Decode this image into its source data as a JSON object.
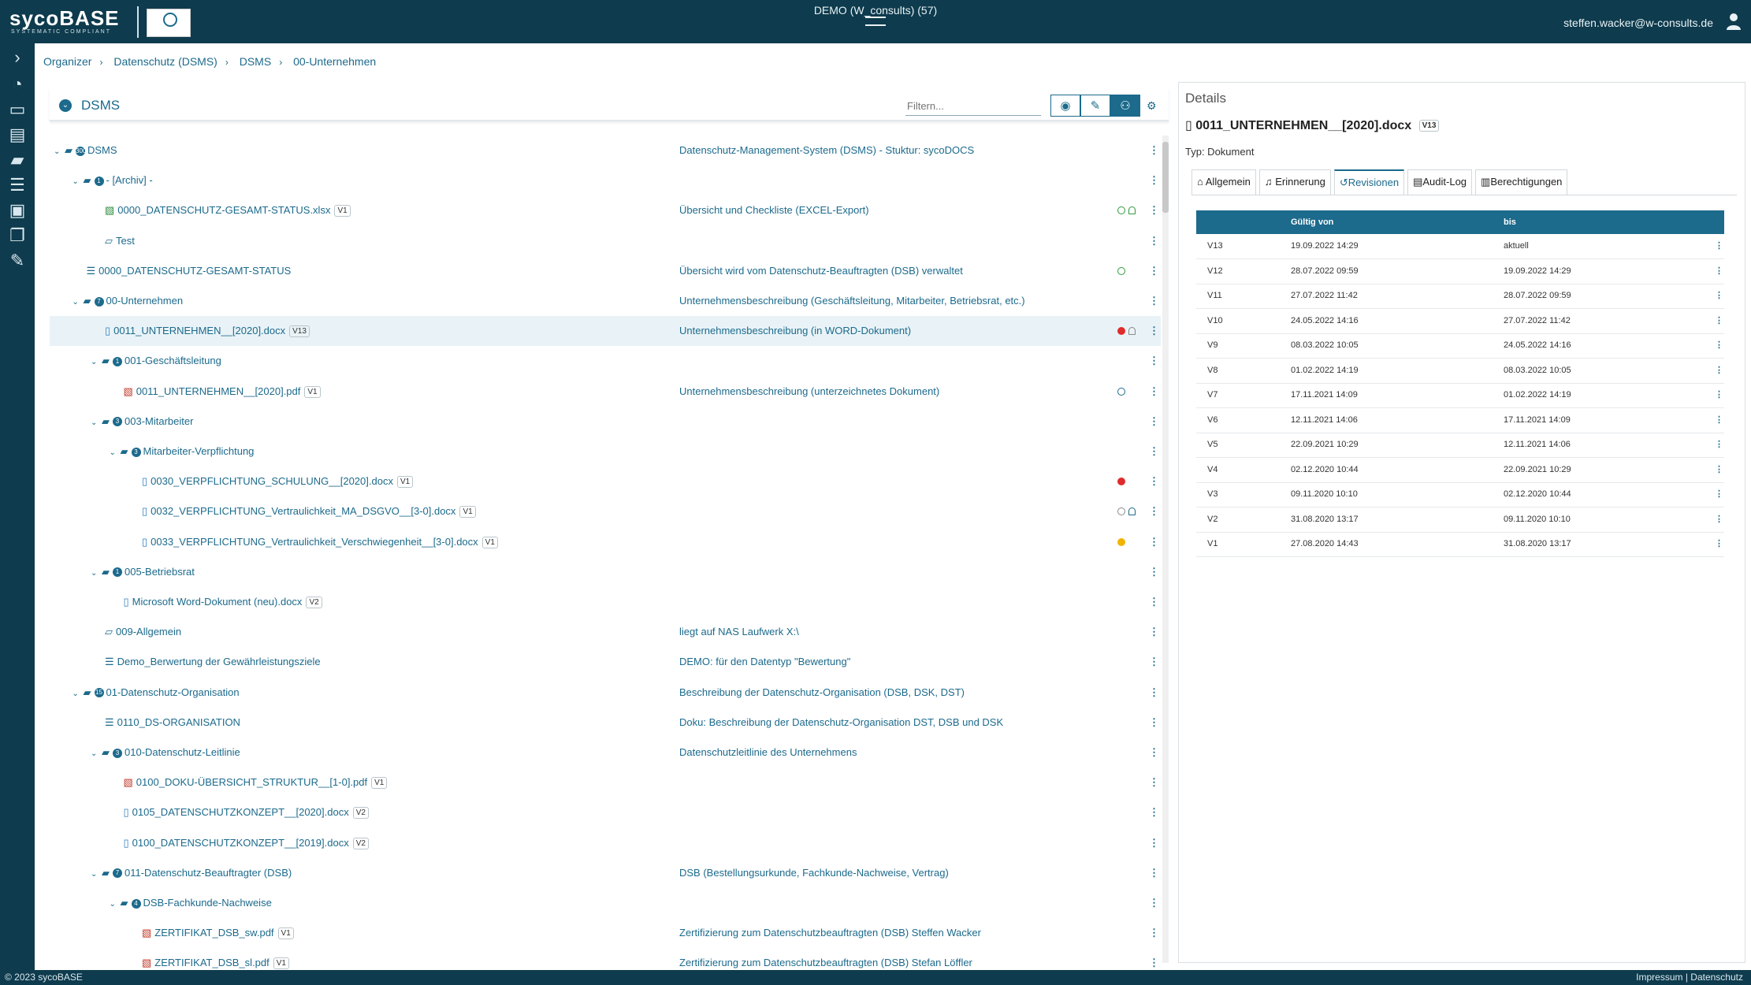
{
  "header": {
    "logo": "sycoBASE",
    "logo_tagline": "SYSTEMATIC COMPLIANT",
    "center_title": "DEMO (W_consults) (57)",
    "user_email": "steffen.wacker@w-consults.de"
  },
  "breadcrumb": [
    "Organizer",
    "Datenschutz (DSMS)",
    "DSMS",
    "00-Unternehmen"
  ],
  "left_panel": {
    "title": "DSMS",
    "filter_placeholder": "Filtern..."
  },
  "tree": [
    {
      "name": "DSMS",
      "desc": "Datenschutz-Management-System (DSMS) - Stuktur: sycoDOCS",
      "level": 0,
      "type": "folder",
      "expanded": true,
      "count": "300"
    },
    {
      "name": "- [Archiv] -",
      "desc": "",
      "level": 1,
      "type": "folder",
      "expanded": true,
      "count": "1"
    },
    {
      "name": "0000_DATENSCHUTZ-GESAMT-STATUS.xlsx",
      "version": "V1",
      "desc": "Übersicht und Checkliste (EXCEL-Export)",
      "level": 2,
      "type": "xlsx",
      "status": "ok-bell"
    },
    {
      "name": "Test",
      "desc": "",
      "level": 2,
      "type": "folder-open"
    },
    {
      "name": "0000_DATENSCHUTZ-GESAMT-STATUS",
      "desc": "Übersicht wird vom Datenschutz-Beauftragten (DSB) verwaltet",
      "level": 1,
      "type": "list",
      "status": "ok"
    },
    {
      "name": "00-Unternehmen",
      "desc": "Unternehmensbeschreibung (Geschäftsleitung, Mitarbeiter, Betriebsrat, etc.)",
      "level": 1,
      "type": "folder",
      "expanded": true,
      "count": "7"
    },
    {
      "name": "0011_UNTERNEHMEN__[2020].docx",
      "version": "V13",
      "desc": "Unternehmensbeschreibung (in WORD-Dokument)",
      "level": 2,
      "type": "doc",
      "status": "error-nobell",
      "selected": true
    },
    {
      "name": "001-Geschäftsleitung",
      "desc": "",
      "level": 2,
      "type": "folder",
      "expanded": true,
      "count": "1"
    },
    {
      "name": "0011_UNTERNEHMEN__[2020].pdf",
      "version": "V1",
      "desc": "Unternehmensbeschreibung (unterzeichnetes Dokument)",
      "level": 3,
      "type": "pdf",
      "status": "play"
    },
    {
      "name": "003-Mitarbeiter",
      "desc": "",
      "level": 2,
      "type": "folder",
      "expanded": true,
      "count": "3"
    },
    {
      "name": "Mitarbeiter-Verpflichtung",
      "desc": "",
      "level": 3,
      "type": "folder",
      "expanded": true,
      "count": "3"
    },
    {
      "name": "0030_VERPFLICHTUNG_SCHULUNG__[2020].docx",
      "version": "V1",
      "desc": "",
      "level": 4,
      "type": "doc",
      "status": "error"
    },
    {
      "name": "0032_VERPFLICHTUNG_Vertraulichkeit_MA_DSGVO__[3-0].docx",
      "version": "V1",
      "desc": "",
      "level": 4,
      "type": "doc",
      "status": "record-bell"
    },
    {
      "name": "0033_VERPFLICHTUNG_Vertraulichkeit_Verschwiegenheit__[3-0].docx",
      "version": "V1",
      "desc": "",
      "level": 4,
      "type": "doc",
      "status": "warn"
    },
    {
      "name": "005-Betriebsrat",
      "desc": "",
      "level": 2,
      "type": "folder",
      "expanded": true,
      "count": "1"
    },
    {
      "name": "Microsoft Word-Dokument (neu).docx",
      "version": "V2",
      "desc": "",
      "level": 3,
      "type": "doc"
    },
    {
      "name": "009-Allgemein",
      "desc": "liegt auf NAS Laufwerk X:\\",
      "level": 2,
      "type": "folder-open"
    },
    {
      "name": "Demo_Berwertung der Gewährleistungsziele",
      "desc": "DEMO: für den Datentyp \"Bewertung\"",
      "level": 2,
      "type": "list"
    },
    {
      "name": "01-Datenschutz-Organisation",
      "desc": "Beschreibung der Datenschutz-Organisation (DSB, DSK, DST)",
      "level": 1,
      "type": "folder",
      "expanded": true,
      "count": "15"
    },
    {
      "name": "0110_DS-ORGANISATION",
      "desc": "Doku: Beschreibung der Datenschutz-Organisation DST, DSB und DSK",
      "level": 2,
      "type": "list"
    },
    {
      "name": "010-Datenschutz-Leitlinie",
      "desc": "Datenschutzleitlinie des Unternehmens",
      "level": 2,
      "type": "folder",
      "expanded": true,
      "count": "3"
    },
    {
      "name": "0100_DOKU-ÜBERSICHT_STRUKTUR__[1-0].pdf",
      "version": "V1",
      "desc": "",
      "level": 3,
      "type": "pdf"
    },
    {
      "name": "0105_DATENSCHUTZKONZEPT__[2020].docx",
      "version": "V2",
      "desc": "",
      "level": 3,
      "type": "doc"
    },
    {
      "name": "0100_DATENSCHUTZKONZEPT__[2019].docx",
      "version": "V2",
      "desc": "",
      "level": 3,
      "type": "doc"
    },
    {
      "name": "011-Datenschutz-Beauftragter (DSB)",
      "desc": "DSB (Bestellungsurkunde, Fachkunde-Nachweise, Vertrag)",
      "level": 2,
      "type": "folder",
      "expanded": true,
      "count": "7"
    },
    {
      "name": "DSB-Fachkunde-Nachweise",
      "desc": "",
      "level": 3,
      "type": "folder",
      "expanded": true,
      "count": "4"
    },
    {
      "name": "ZERTIFIKAT_DSB_sw.pdf",
      "version": "V1",
      "desc": "Zertifizierung zum Datenschutzbeauftragten (DSB) Steffen Wacker",
      "level": 4,
      "type": "pdf"
    },
    {
      "name": "ZERTIFIKAT_DSB_sl.pdf",
      "version": "V1",
      "desc": "Zertifizierung zum Datenschutzbeauftragten (DSB) Stefan Löffler",
      "level": 4,
      "type": "pdf"
    }
  ],
  "details": {
    "heading": "Details",
    "doc_name": "0011_UNTERNEHMEN__[2020].docx",
    "doc_version": "V13",
    "type_label": "Typ: Dokument",
    "tabs": [
      "Allgemein",
      "Erinnerung",
      "Revisionen",
      "Audit-Log",
      "Berechtigungen"
    ],
    "active_tab": "Revisionen",
    "columns": [
      "",
      "Gültig von",
      "bis"
    ],
    "revisions": [
      {
        "v": "V13",
        "from": "19.09.2022 14:29",
        "to": "aktuell"
      },
      {
        "v": "V12",
        "from": "28.07.2022 09:59",
        "to": "19.09.2022 14:29"
      },
      {
        "v": "V11",
        "from": "27.07.2022 11:42",
        "to": "28.07.2022 09:59"
      },
      {
        "v": "V10",
        "from": "24.05.2022 14:16",
        "to": "27.07.2022 11:42"
      },
      {
        "v": "V9",
        "from": "08.03.2022 10:05",
        "to": "24.05.2022 14:16"
      },
      {
        "v": "V8",
        "from": "01.02.2022 14:19",
        "to": "08.03.2022 10:05"
      },
      {
        "v": "V7",
        "from": "17.11.2021 14:09",
        "to": "01.02.2022 14:19"
      },
      {
        "v": "V6",
        "from": "12.11.2021 14:06",
        "to": "17.11.2021 14:09"
      },
      {
        "v": "V5",
        "from": "22.09.2021 10:29",
        "to": "12.11.2021 14:06"
      },
      {
        "v": "V4",
        "from": "02.12.2020 10:44",
        "to": "22.09.2021 10:29"
      },
      {
        "v": "V3",
        "from": "09.11.2020 10:10",
        "to": "02.12.2020 10:44"
      },
      {
        "v": "V2",
        "from": "31.08.2020 13:17",
        "to": "09.11.2020 10:10"
      },
      {
        "v": "V1",
        "from": "27.08.2020 14:43",
        "to": "31.08.2020 13:17"
      }
    ]
  },
  "footer": {
    "copyright": "© 2023 sycoBASE",
    "links": "Impressum | Datenschutz"
  },
  "colors": {
    "dark": "#0e3b4d",
    "accent": "#1c6a8c",
    "ok": "#2e9b3d",
    "error": "#e02b2b",
    "warn": "#f0b400"
  }
}
